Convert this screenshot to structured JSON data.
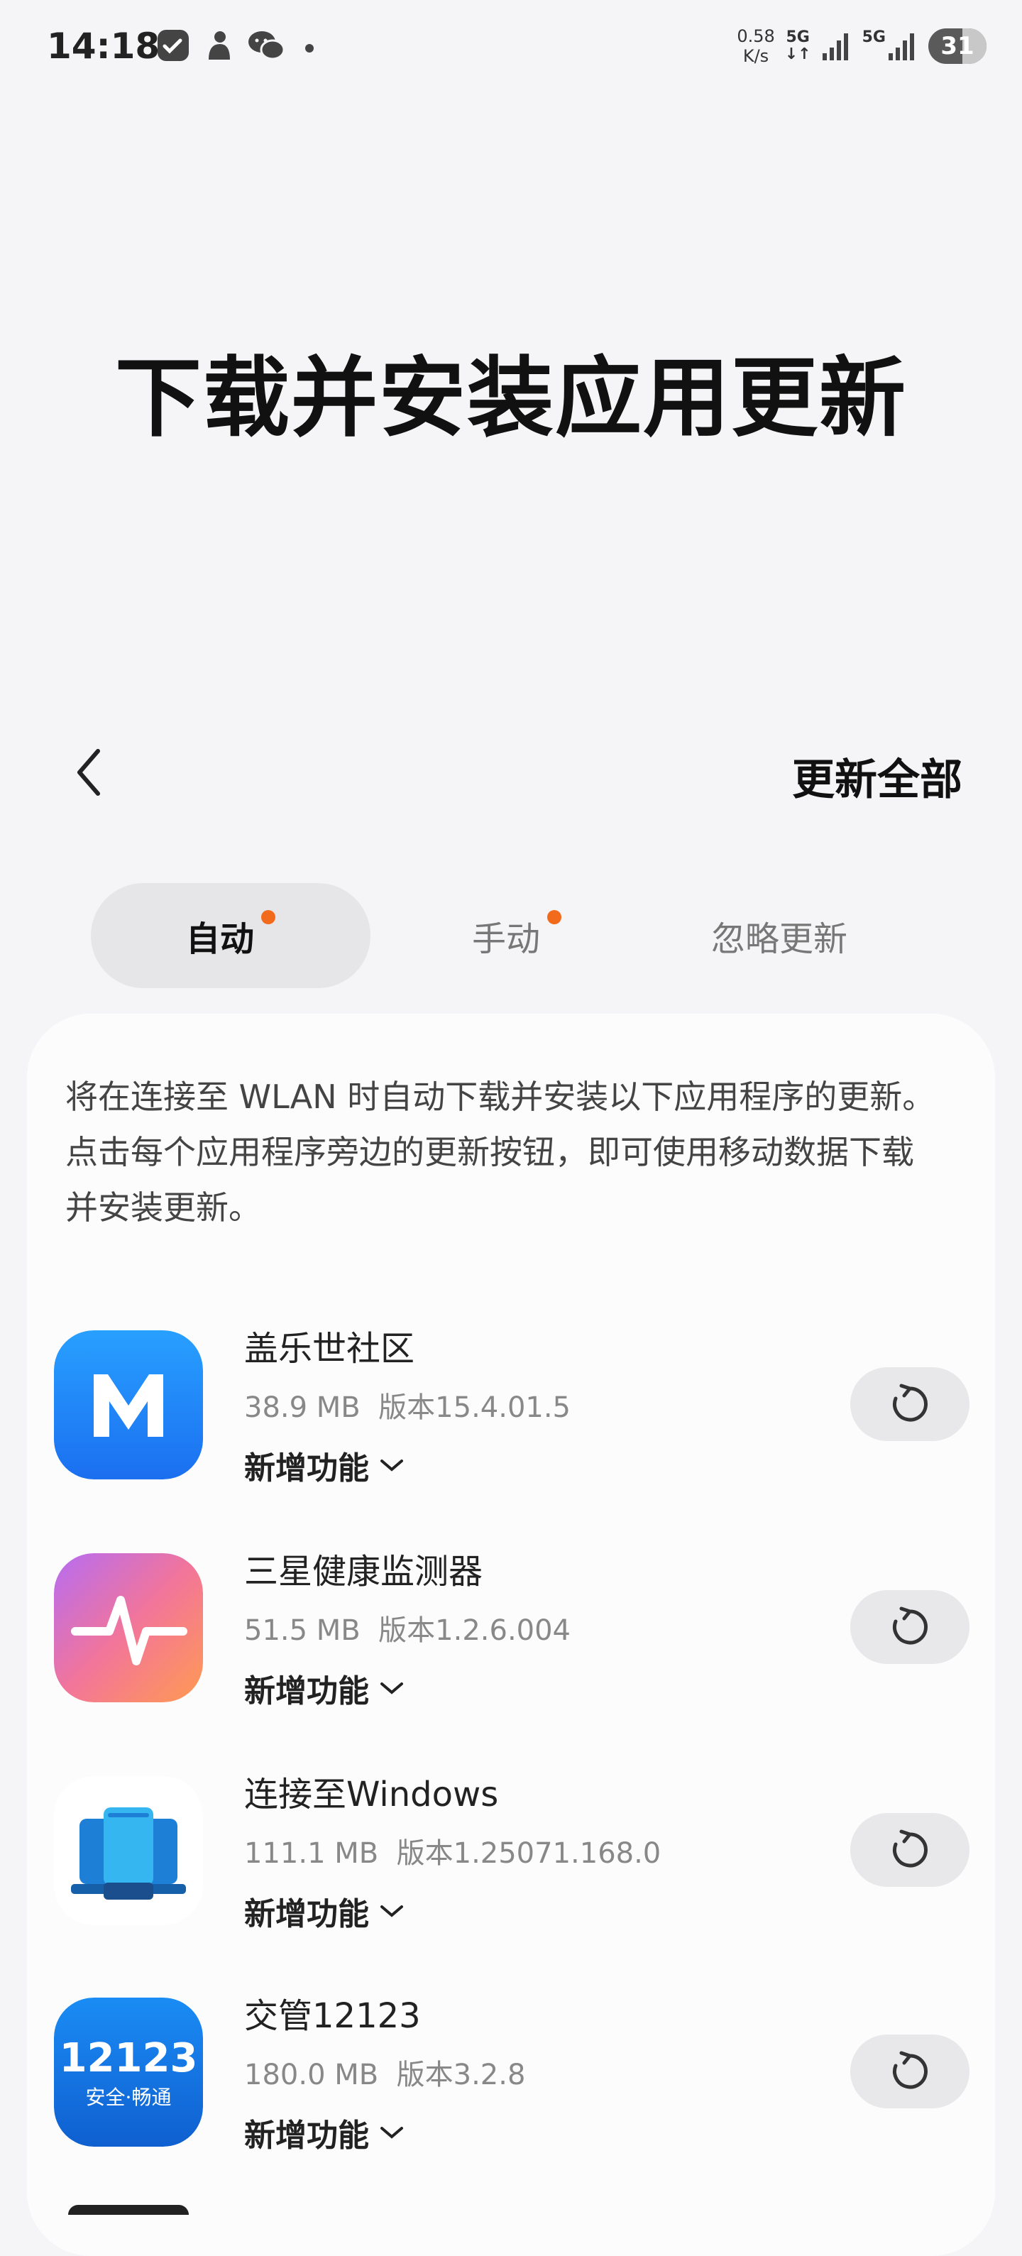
{
  "status_bar": {
    "time": "14:18",
    "net_speed_value": "0.58",
    "net_speed_unit": "K/s",
    "net_type_1": "5G",
    "net_type_2": "5G",
    "battery": "31",
    "icons": [
      "app-notification-icon",
      "baby-app-icon",
      "wechat-icon",
      "more-dot-icon",
      "signal-icon",
      "battery-icon"
    ]
  },
  "page": {
    "title": "下载并安装应用更新",
    "update_all": "更新全部"
  },
  "tabs": [
    {
      "label": "自动",
      "selected": true,
      "dot": true
    },
    {
      "label": "手动",
      "selected": false,
      "dot": true
    },
    {
      "label": "忽略更新",
      "selected": false,
      "dot": false
    }
  ],
  "intro": "将在连接至 WLAN 时自动下载并安装以下应用程序的更新。点击每个应用程序旁边的更新按钮，即可使用移动数据下载并安装更新。",
  "apps": [
    {
      "name": "盖乐世社区",
      "size": "38.9 MB",
      "version": "版本15.4.01.5",
      "features": "新增功能"
    },
    {
      "name": "三星健康监测器",
      "size": "51.5 MB",
      "version": "版本1.2.6.004",
      "features": "新增功能"
    },
    {
      "name": "连接至Windows",
      "size": "111.1 MB",
      "version": "版本1.25071.168.0",
      "features": "新增功能"
    },
    {
      "name": "交管12123",
      "size": "180.0 MB",
      "version": "版本3.2.8",
      "features": "新增功能",
      "icon_text_1": "12123",
      "icon_text_2": "安全·畅通"
    }
  ],
  "colors": {
    "accent_dot": "#f26a1b",
    "tab_selected_bg": "#e6e6e8"
  }
}
